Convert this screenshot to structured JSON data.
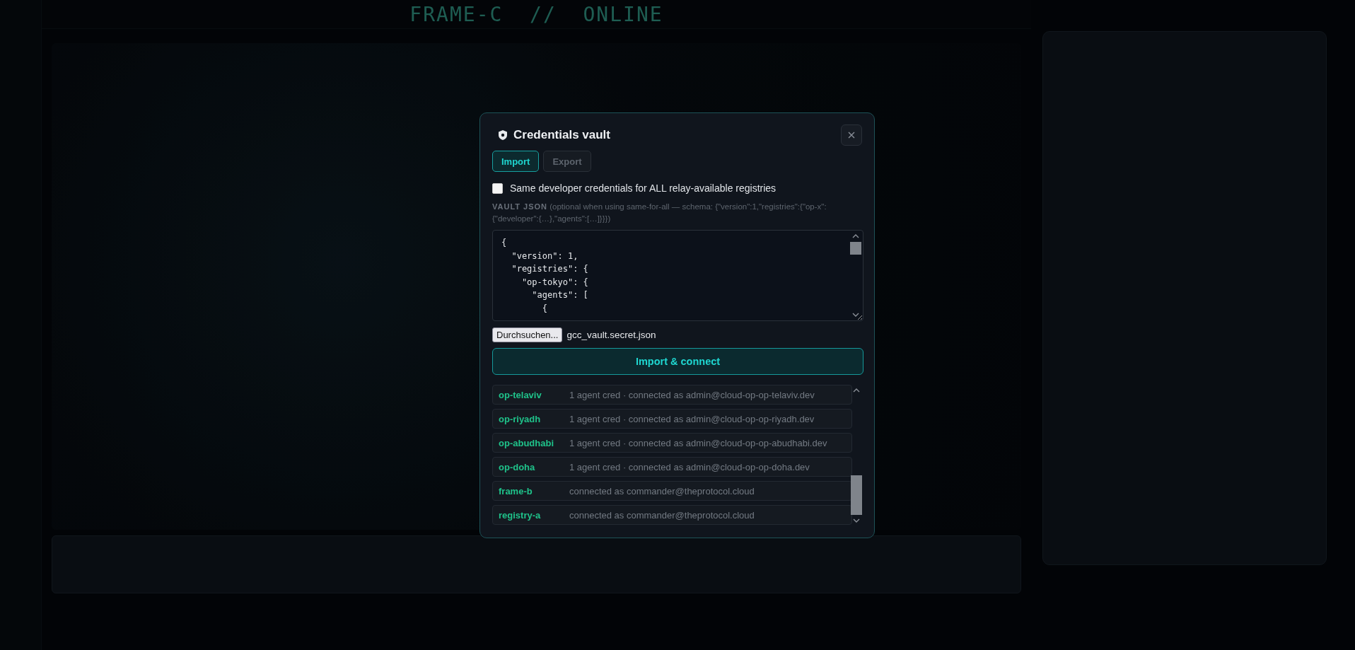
{
  "backdrop": {
    "title": "FRAME-C  //  ONLINE"
  },
  "dialog": {
    "title": "Credentials vault",
    "tabs": [
      {
        "label": "Import",
        "selected": true
      },
      {
        "label": "Export",
        "selected": false
      }
    ],
    "same_for_all": {
      "label": "Same developer credentials for ALL relay-available registries",
      "checked": false
    },
    "vault_json": {
      "label": "**VAULT JSON** (optional when using same-for-all — schema: {\"version\":1,\"registries\":{\"op-x\":{\"developer\":{…},\"agents\":[…]}}})",
      "value": "{\n  \"version\": 1,\n  \"registries\": {\n    \"op-tokyo\": {\n      \"agents\": [\n        {"
    },
    "file": {
      "button": "Durchsuchen...",
      "filename": "gcc_vault.secret.json"
    },
    "submit": "Import & connect",
    "registries": [
      {
        "name": "op-telaviv",
        "detail": "1 agent cred · connected as admin@cloud-op-op-telaviv.dev"
      },
      {
        "name": "op-riyadh",
        "detail": "1 agent cred · connected as admin@cloud-op-op-riyadh.dev"
      },
      {
        "name": "op-abudhabi",
        "detail": "1 agent cred · connected as admin@cloud-op-op-abudhabi.dev"
      },
      {
        "name": "op-doha",
        "detail": "1 agent cred · connected as admin@cloud-op-op-doha.dev"
      },
      {
        "name": "frame-b",
        "detail": "connected as commander@theprotocol.cloud"
      },
      {
        "name": "registry-a",
        "detail": "connected as commander@theprotocol.cloud"
      }
    ]
  }
}
